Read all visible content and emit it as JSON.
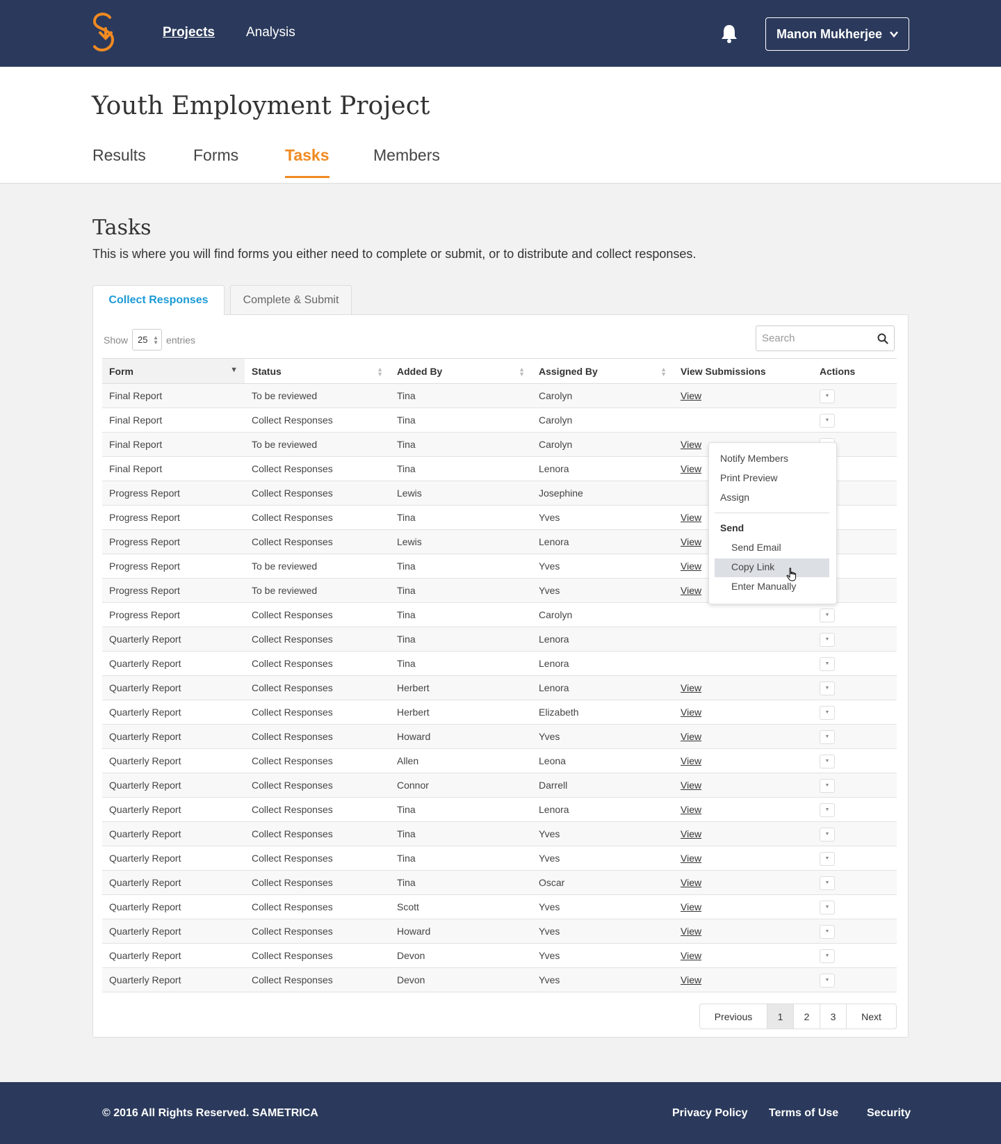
{
  "header": {
    "nav": {
      "projects": "Projects",
      "analysis": "Analysis"
    },
    "user_name": "Manon Mukherjee",
    "colors": {
      "bar": "#2b3a5c",
      "accent": "#f18a21"
    }
  },
  "project": {
    "title": "Youth Employment Project",
    "tabs": [
      "Results",
      "Forms",
      "Tasks",
      "Members"
    ],
    "active_tab": "Tasks"
  },
  "tasks": {
    "title": "Tasks",
    "description": "This is where you will find forms you either need to complete or submit, or to distribute and collect responses.",
    "tabs": {
      "collect": "Collect Responses",
      "complete": "Complete & Submit"
    },
    "show_label": "Show",
    "entries_value": "25",
    "entries_label": "entries",
    "search_placeholder": "Search",
    "columns": [
      "Form",
      "Status",
      "Added By",
      "Assigned By",
      "View Submissions",
      "Actions"
    ],
    "rows": [
      [
        "Final Report",
        "To be reviewed",
        "Tina",
        "Carolyn",
        "View"
      ],
      [
        "Final Report",
        "Collect Responses",
        "Tina",
        "Carolyn",
        ""
      ],
      [
        "Final Report",
        "To be reviewed",
        "Tina",
        "Carolyn",
        "View"
      ],
      [
        "Final Report",
        "Collect Responses",
        "Tina",
        "Lenora",
        "View"
      ],
      [
        "Progress Report",
        "Collect Responses",
        "Lewis",
        "Josephine",
        ""
      ],
      [
        "Progress Report",
        "Collect Responses",
        "Tina",
        "Yves",
        "View"
      ],
      [
        "Progress Report",
        "Collect Responses",
        "Lewis",
        "Lenora",
        "View"
      ],
      [
        "Progress Report",
        "To be reviewed",
        "Tina",
        "Yves",
        "View"
      ],
      [
        "Progress Report",
        "To be reviewed",
        "Tina",
        "Yves",
        "View"
      ],
      [
        "Progress Report",
        "Collect Responses",
        "Tina",
        "Carolyn",
        ""
      ],
      [
        "Quarterly Report",
        "Collect Responses",
        "Tina",
        "Lenora",
        ""
      ],
      [
        "Quarterly Report",
        "Collect Responses",
        "Tina",
        "Lenora",
        ""
      ],
      [
        "Quarterly Report",
        "Collect Responses",
        "Herbert",
        "Lenora",
        "View"
      ],
      [
        "Quarterly Report",
        "Collect Responses",
        "Herbert",
        "Elizabeth",
        "View"
      ],
      [
        "Quarterly Report",
        "Collect Responses",
        "Howard",
        "Yves",
        "View"
      ],
      [
        "Quarterly Report",
        "Collect Responses",
        "Allen",
        "Leona",
        "View"
      ],
      [
        "Quarterly Report",
        "Collect Responses",
        "Connor",
        "Darrell",
        "View"
      ],
      [
        "Quarterly Report",
        "Collect Responses",
        "Tina",
        "Lenora",
        "View"
      ],
      [
        "Quarterly Report",
        "Collect Responses",
        "Tina",
        "Yves",
        "View"
      ],
      [
        "Quarterly Report",
        "Collect Responses",
        "Tina",
        "Yves",
        "View"
      ],
      [
        "Quarterly Report",
        "Collect Responses",
        "Tina",
        "Oscar",
        "View"
      ],
      [
        "Quarterly Report",
        "Collect Responses",
        "Scott",
        "Yves",
        "View"
      ],
      [
        "Quarterly Report",
        "Collect Responses",
        "Howard",
        "Yves",
        "View"
      ],
      [
        "Quarterly Report",
        "Collect Responses",
        "Devon",
        "Yves",
        "View"
      ],
      [
        "Quarterly Report",
        "Collect Responses",
        "Devon",
        "Yves",
        "View"
      ]
    ],
    "dropdown": {
      "items": [
        "Notify Members",
        "Print Preview",
        "Assign"
      ],
      "send_header": "Send",
      "send_items": [
        "Send Email",
        "Copy Link",
        "Enter Manually"
      ],
      "highlighted": "Copy Link"
    },
    "pagination": {
      "previous": "Previous",
      "pages": [
        "1",
        "2",
        "3"
      ],
      "current": "1",
      "next": "Next"
    }
  },
  "footer": {
    "copyright": "© 2016 All Rights Reserved. SAMETRICA",
    "links": [
      "Privacy Policy",
      "Terms of Use",
      "Security"
    ]
  }
}
